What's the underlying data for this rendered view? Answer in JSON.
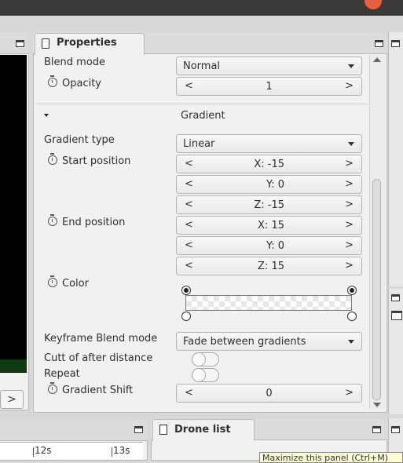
{
  "properties_panel": {
    "tab_label": "Properties",
    "rows": {
      "blend_mode": {
        "label": "Blend mode",
        "value": "Normal"
      },
      "opacity": {
        "label": "Opacity",
        "value": "1"
      },
      "gradient_section": {
        "label": "Gradient"
      },
      "gradient_type": {
        "label": "Gradient type",
        "value": "Linear"
      },
      "start_position": {
        "label": "Start position",
        "x": "X: -15",
        "y": "Y: 0",
        "z": "Z: -15"
      },
      "end_position": {
        "label": "End position",
        "x": "X: 15",
        "y": "Y: 0",
        "z": "Z: 15"
      },
      "color": {
        "label": "Color"
      },
      "keyframe_blend_mode": {
        "label": "Keyframe Blend mode",
        "value": "Fade between gradients"
      },
      "cut_off_after_distance": {
        "label": "Cutt of after distance",
        "on": false
      },
      "repeat": {
        "label": "Repeat",
        "on": false
      },
      "gradient_shift": {
        "label": "Gradient Shift",
        "value": "0"
      }
    },
    "spinner_left": "<",
    "spinner_right": ">"
  },
  "left_panel": {
    "arrow_label": ">"
  },
  "timeline": {
    "ticks": [
      "12s",
      "13s"
    ]
  },
  "drone_panel": {
    "tab_label": "Drone list"
  },
  "tooltip": {
    "text": "Maximize this panel (Ctrl+M)"
  },
  "colors": {
    "accent_close": "#e9603a",
    "panel_bg": "#f1f1f0",
    "chrome": "#dcdcda"
  }
}
